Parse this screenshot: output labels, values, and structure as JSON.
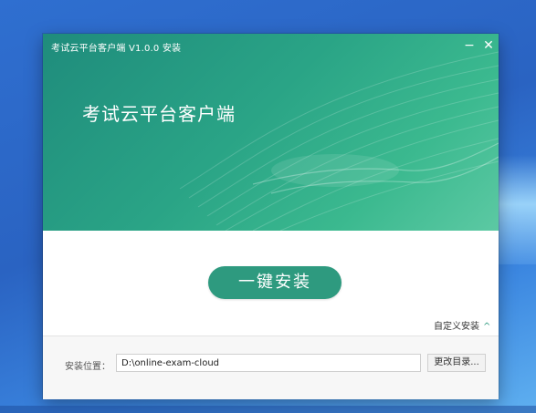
{
  "window": {
    "title": "考试云平台客户端 V1.0.0 安装",
    "minimize_glyph": "−",
    "close_glyph": "✕"
  },
  "banner": {
    "heading": "考试云平台客户端"
  },
  "actions": {
    "install_label": "一键安装",
    "custom_install_label": "自定义安装",
    "custom_install_icon": "chevron-up-icon",
    "chevron_glyph": "^"
  },
  "install_path": {
    "label": "安装位置：",
    "value": "D:\\online-exam-cloud",
    "browse_label": "更改目录..."
  },
  "colors": {
    "accent": "#2e9a7f",
    "banner_start": "#1f8c7c",
    "banner_end": "#5cc9a3"
  }
}
